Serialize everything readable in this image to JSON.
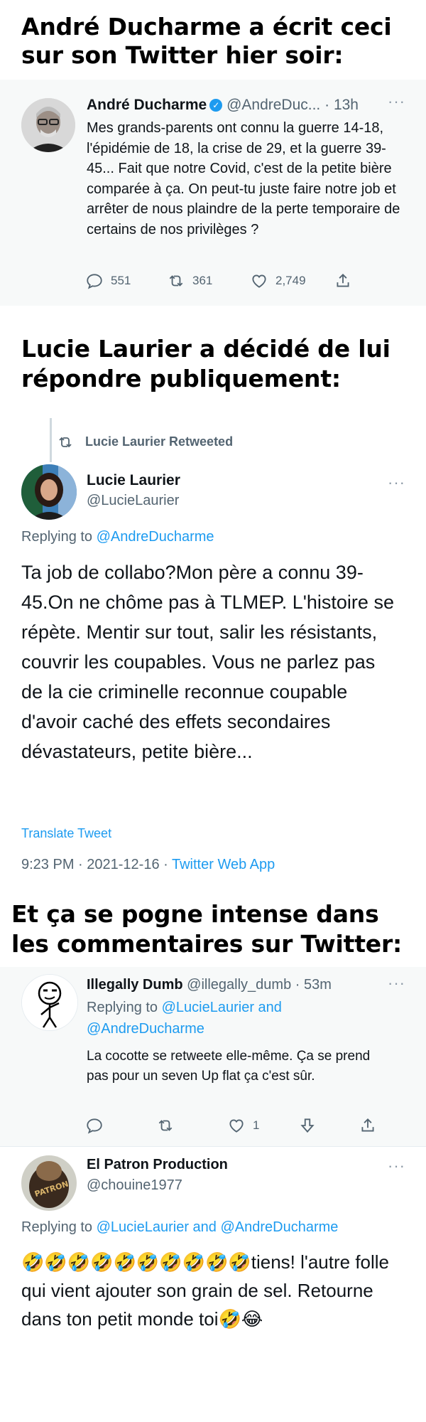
{
  "captions": {
    "intro": "André Ducharme a écrit ceci sur son Twitter hier soir:",
    "reply_intro": "Lucie Laurier a décidé de lui répondre publiquement:",
    "comments_intro": "Et ça se pogne intense dans les commentaires sur Twitter:"
  },
  "tweet1": {
    "name": "André Ducharme",
    "handle": "@AndreDuc...",
    "time": "· 13h",
    "text": "Mes grands-parents ont connu la guerre 14-18, l'épidémie de 18, la crise de 29, et la guerre 39-45... Fait que notre Covid, c'est de la petite bière comparée à ça. On peut-tu juste faire notre job et arrêter de nous plaindre de la perte temporaire de certains de nos privilèges ?",
    "replies": "551",
    "retweets": "361",
    "likes": "2,749"
  },
  "tweet2": {
    "retweeted_label": "Lucie Laurier Retweeted",
    "name": "Lucie Laurier",
    "handle": "@LucieLaurier",
    "replying_prefix": "Replying to",
    "replying_to": "@AndreDucharme",
    "text": "Ta job de collabo?Mon père a connu 39-45.On ne chôme pas à TLMEP. L'histoire se répète. Mentir sur tout, salir les résistants, couvrir les coupables. Vous ne parlez pas de la cie criminelle reconnue coupable d'avoir caché des effets secondaires dévastateurs, petite bière...",
    "translate": "Translate Tweet",
    "timestamp": "9:23 PM · 2021-12-16 · ",
    "source": "Twitter Web App"
  },
  "comment1": {
    "name": "Illegally Dumb",
    "handle": "@illegally_dumb",
    "time": "· 53m",
    "replying_prefix": "Replying to",
    "replying_to": "@LucieLaurier and @AndreDucharme",
    "text": "La cocotte se retweete elle-même. Ça se prend pas pour un seven Up flat ça c'est sûr.",
    "likes": "1"
  },
  "comment2": {
    "name": "El Patron Production",
    "handle": "@chouine1977",
    "replying_prefix": "Replying to",
    "replying_to": "@LucieLaurier and @AndreDucharme",
    "text": "🤣🤣🤣🤣🤣🤣🤣🤣🤣🤣tiens! l'autre folle qui vient ajouter son grain de sel. Retourne dans ton petit monde toi🤣😂"
  },
  "colors": {
    "link": "#1d9bf0",
    "muted": "#536471",
    "panel": "#f7f9f9"
  }
}
